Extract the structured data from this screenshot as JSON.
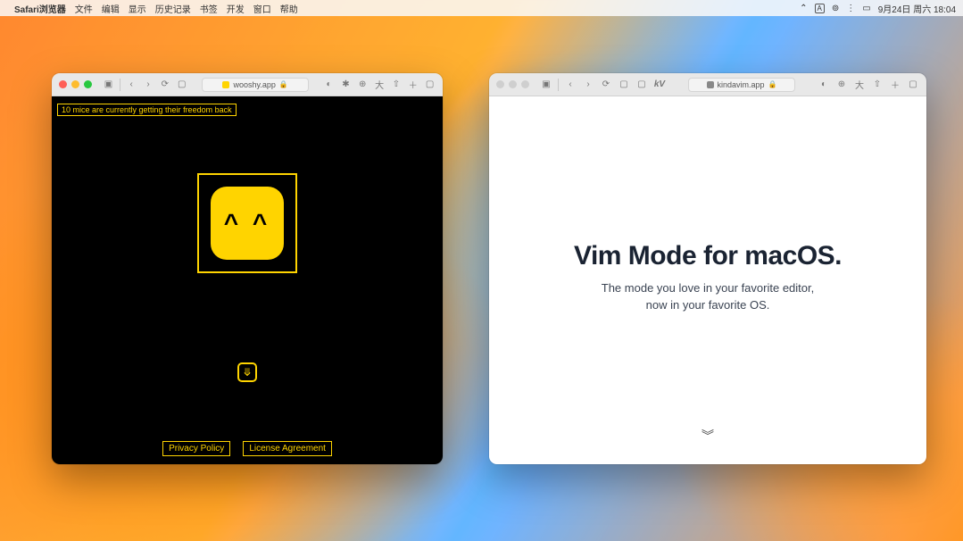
{
  "menubar": {
    "apple": "",
    "app_name": "Safari浏览器",
    "items": [
      "文件",
      "编辑",
      "显示",
      "历史记录",
      "书签",
      "开发",
      "窗口",
      "帮助"
    ],
    "status": {
      "shortcut": "⌃",
      "input": "A",
      "wifi": "⊚",
      "signal": "⋮",
      "battery": "▭",
      "date": "9月24日 周六 18:04"
    }
  },
  "left_window": {
    "address": "wooshy.app",
    "banner": "10 mice are currently getting their freedom back",
    "logo_face": "^  ^",
    "scroll_glyph": "⤋",
    "footer": {
      "privacy": "Privacy Policy",
      "license": "License Agreement"
    }
  },
  "right_window": {
    "address": "kindavim.app",
    "tab_label": "kV",
    "headline": "Vim Mode for macOS.",
    "sub1": "The mode you love in your favorite editor,",
    "sub2": "now in your favorite OS.",
    "chevron": "︾"
  }
}
